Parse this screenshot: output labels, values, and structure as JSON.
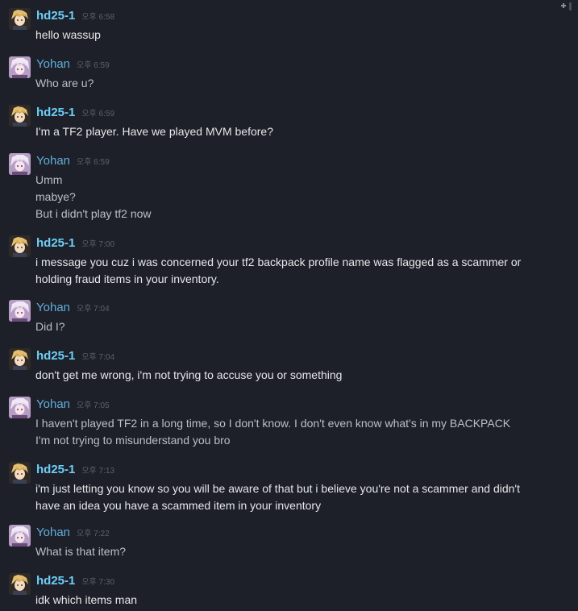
{
  "messages": [
    {
      "author": "hd25-1",
      "time": "오후 6:58",
      "lines": [
        "hello wassup"
      ]
    },
    {
      "author": "Yohan",
      "time": "오후 6:59",
      "lines": [
        "Who are u?"
      ]
    },
    {
      "author": "hd25-1",
      "time": "오후 6:59",
      "lines": [
        "I'm a TF2 player. Have we played MVM before?"
      ]
    },
    {
      "author": "Yohan",
      "time": "오후 6:59",
      "lines": [
        "Umm",
        "mabye?",
        "But i didn't play tf2 now"
      ]
    },
    {
      "author": "hd25-1",
      "time": "오후 7:00",
      "lines": [
        "i message you cuz i was concerned your tf2 backpack profile name was flagged as a scammer or",
        "holding fraud items in your inventory."
      ]
    },
    {
      "author": "Yohan",
      "time": "오후 7:04",
      "lines": [
        "Did I?"
      ]
    },
    {
      "author": "hd25-1",
      "time": "오후 7:04",
      "lines": [
        "don't get me wrong, i'm not trying to accuse you or something"
      ]
    },
    {
      "author": "Yohan",
      "time": "오후 7:05",
      "lines": [
        "I haven't played TF2 in a long time, so I don't know. I don't even know what's in my BACKPACK",
        "I'm not trying to misunderstand you bro"
      ]
    },
    {
      "author": "hd25-1",
      "time": "오후 7:13",
      "lines": [
        "i'm just letting you know so you will be aware of that but i believe you're not a scammer and didn't",
        "have an idea you have a scammed item in your inventory"
      ]
    },
    {
      "author": "Yohan",
      "time": "오후 7:22",
      "lines": [
        "What is that item?"
      ]
    },
    {
      "author": "hd25-1",
      "time": "오후 7:30",
      "lines": [
        "idk which items man"
      ]
    }
  ]
}
